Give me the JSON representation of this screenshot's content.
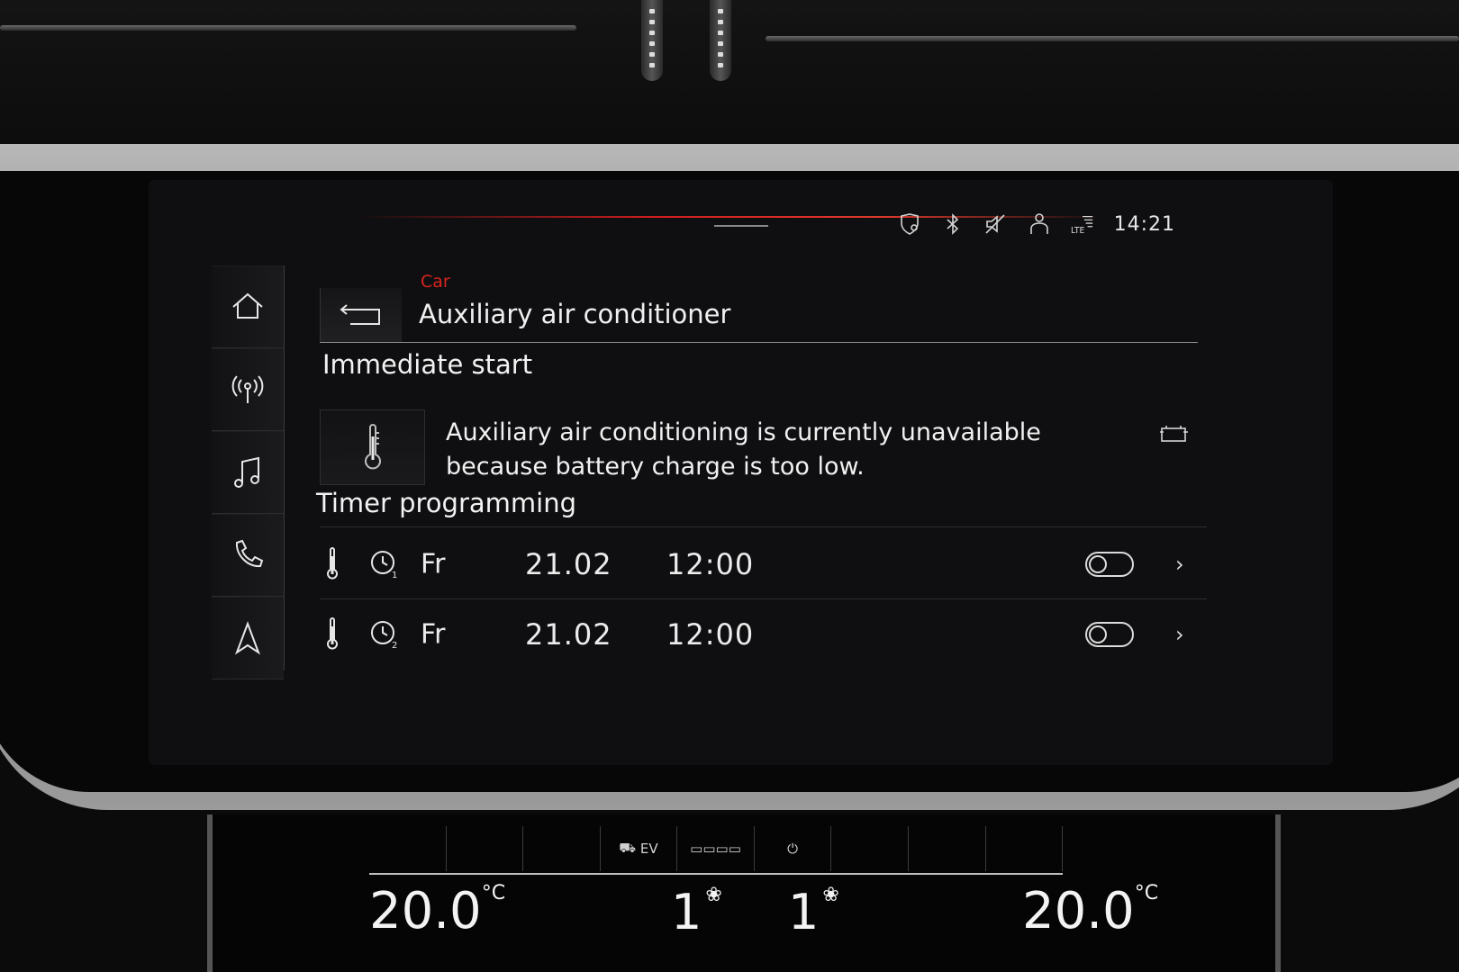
{
  "status_bar": {
    "time": "14:21",
    "icons": [
      "location-shield-icon",
      "bluetooth-icon",
      "mute-icon",
      "user-profile-icon",
      "lte-signal-icon"
    ]
  },
  "sidebar": {
    "items": [
      {
        "icon": "home-icon"
      },
      {
        "icon": "radio-antenna-icon"
      },
      {
        "icon": "music-note-icon"
      },
      {
        "icon": "phone-icon"
      },
      {
        "icon": "navigation-arrow-icon"
      }
    ]
  },
  "header": {
    "breadcrumb": "Car",
    "title": "Auxiliary air conditioner",
    "back_icon": "back-arrow-icon"
  },
  "immediate_start": {
    "heading": "Immediate start",
    "message_line1": "Auxiliary air conditioning is currently unavailable",
    "message_line2": "because battery charge is too low.",
    "icon": "thermometer-icon",
    "status_icon": "battery-icon"
  },
  "timer_programming": {
    "heading": "Timer programming",
    "timers": [
      {
        "number": "1",
        "day": "Fr",
        "date": "21.02",
        "time": "12:00",
        "enabled": false
      },
      {
        "number": "2",
        "day": "Fr",
        "date": "21.02",
        "time": "12:00",
        "enabled": false
      }
    ]
  },
  "climate": {
    "tabs": [
      "",
      "",
      "",
      "EV",
      "",
      "",
      "",
      "",
      ""
    ],
    "left_temp": "20.0",
    "right_temp": "20.0",
    "temp_unit": "°C",
    "left_fan": "1",
    "right_fan": "1"
  },
  "colors": {
    "accent": "#d8241f",
    "background": "#0f0e10",
    "text": "#f0f0f0"
  }
}
